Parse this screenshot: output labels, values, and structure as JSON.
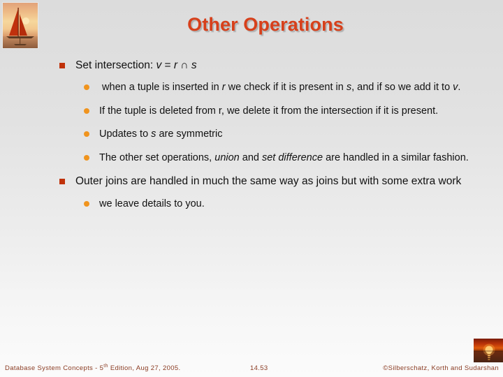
{
  "slide": {
    "title": "Other Operations",
    "bullets": [
      {
        "level": 1,
        "marker": "square-bullet",
        "text_html": "Set intersection: <i>v</i> = <i>r</i> &#8745; <i>s</i>"
      },
      {
        "level": 2,
        "marker": "round-bullet",
        "text_html": "&nbsp;when a tuple is inserted in <i>r</i> we check if it is present in <i>s</i>, and if so we add it to <i>v</i>."
      },
      {
        "level": 2,
        "marker": "round-bullet",
        "text_html": "If the tuple is deleted from r, we delete it from the intersection if it is present."
      },
      {
        "level": 2,
        "marker": "round-bullet",
        "text_html": "Updates to <i>s</i> are symmetric"
      },
      {
        "level": 2,
        "marker": "round-bullet",
        "text_html": "The other set operations, <i>union</i> and <i>set difference</i> are handled in a similar fashion."
      },
      {
        "level": 1,
        "marker": "square-bullet",
        "text_html": "Outer joins are handled in much the same way as joins but with some extra work"
      },
      {
        "level": 2,
        "marker": "round-bullet",
        "text_html": "we leave details to you."
      }
    ]
  },
  "footer": {
    "left_prefix": "Database System Concepts - 5",
    "left_sup": "th",
    "left_suffix": " Edition, Aug 27, 2005.",
    "page_number": "14.53",
    "copyright": "©Silberschatz, Korth and Sudarshan"
  },
  "images": {
    "logo_alt": "sailboat-at-sunset-photo",
    "sunset_alt": "sunset-over-water-photo"
  },
  "colors": {
    "title": "#d7401b",
    "square_bullet": "#c0320a",
    "round_bullet": "#f0941e",
    "footer_text": "#8a3b22",
    "body_text": "#111111"
  }
}
